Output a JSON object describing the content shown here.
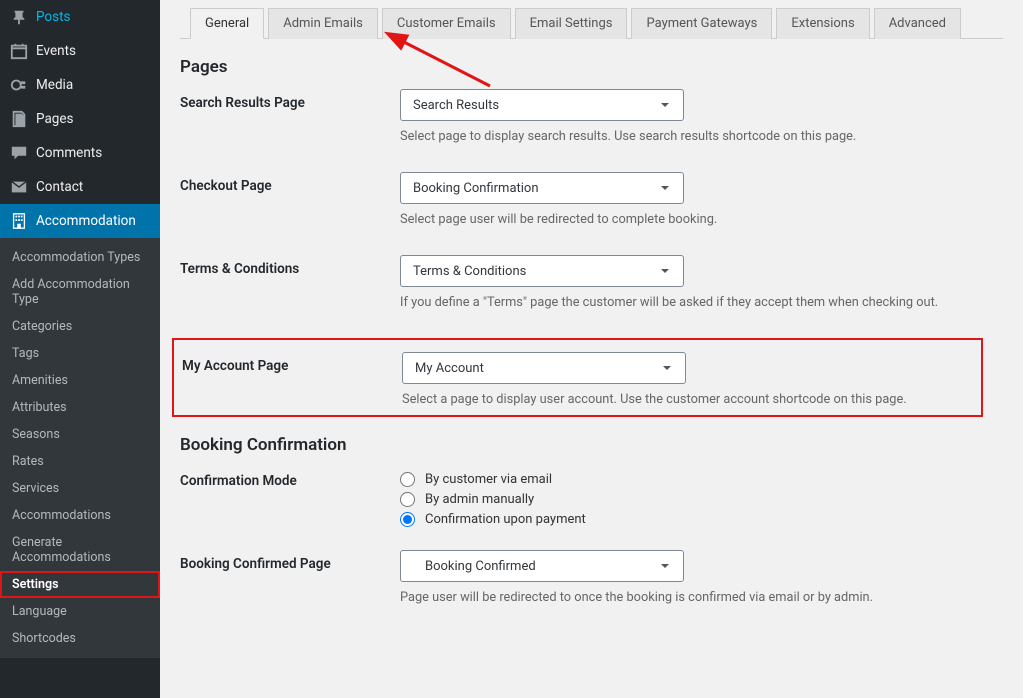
{
  "sidebar": {
    "main": [
      {
        "icon": "pin",
        "label": "Posts"
      },
      {
        "icon": "calendar",
        "label": "Events"
      },
      {
        "icon": "media",
        "label": "Media"
      },
      {
        "icon": "page",
        "label": "Pages"
      },
      {
        "icon": "comment",
        "label": "Comments"
      },
      {
        "icon": "mail",
        "label": "Contact"
      },
      {
        "icon": "building",
        "label": "Accommodation",
        "active": true
      }
    ],
    "sub": [
      "Accommodation Types",
      "Add Accommodation Type",
      "Categories",
      "Tags",
      "Amenities",
      "Attributes",
      "Seasons",
      "Rates",
      "Services",
      "Accommodations",
      "Generate Accommodations",
      "Settings",
      "Language",
      "Shortcodes"
    ],
    "sub_highlight_index": 11
  },
  "tabs": [
    "General",
    "Admin Emails",
    "Customer Emails",
    "Email Settings",
    "Payment Gateways",
    "Extensions",
    "Advanced"
  ],
  "active_tab": 0,
  "pages_section": {
    "title": "Pages",
    "rows": [
      {
        "label": "Search Results Page",
        "select": "Search Results",
        "help": "Select page to display search results. Use search results shortcode on this page."
      },
      {
        "label": "Checkout Page",
        "select": "Booking Confirmation",
        "help": "Select page user will be redirected to complete booking."
      },
      {
        "label": "Terms & Conditions",
        "select": "Terms & Conditions",
        "help": "If you define a \"Terms\" page the customer will be asked if they accept them when checking out."
      },
      {
        "label": "My Account Page",
        "select": "My Account",
        "help": "Select a page to display user account. Use the customer account shortcode on this page.",
        "highlight": true
      }
    ]
  },
  "booking_section": {
    "title": "Booking Confirmation",
    "conf_mode_label": "Confirmation Mode",
    "options": [
      "By customer via email",
      "By admin manually",
      "Confirmation upon payment"
    ],
    "selected": 2,
    "confirmed_page": {
      "label": "Booking Confirmed Page",
      "select": "Booking Confirmed",
      "help": "Page user will be redirected to once the booking is confirmed via email or by admin."
    }
  }
}
